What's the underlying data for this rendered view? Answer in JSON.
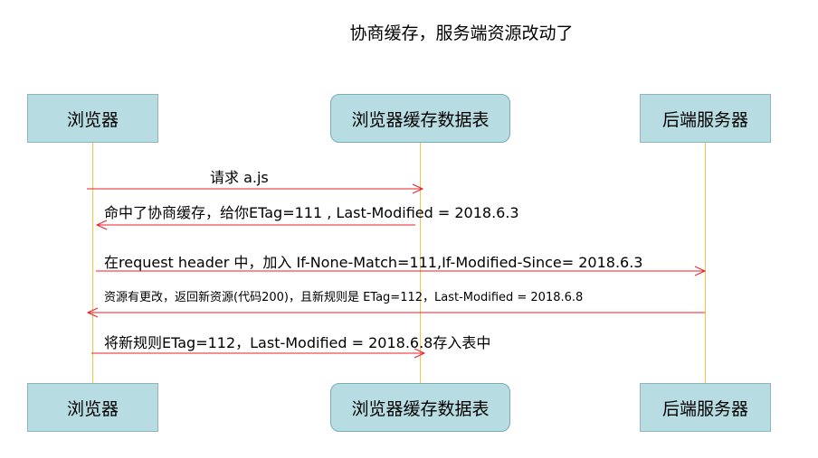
{
  "title": "协商缓存，服务端资源改动了",
  "participants": {
    "browser": "浏览器",
    "cache_table": "浏览器缓存数据表",
    "server": "后端服务器"
  },
  "messages": [
    {
      "text": "请求 a.js",
      "from": "browser",
      "to": "cache_table"
    },
    {
      "text": "命中了协商缓存，给你ETag=111 , Last-Modified = 2018.6.3",
      "from": "cache_table",
      "to": "browser"
    },
    {
      "text": "在request header 中，加入 If-None-Match=111,If-Modified-Since= 2018.6.3",
      "from": "browser",
      "to": "server"
    },
    {
      "text": "资源有更改，返回新资源(代码200)，且新规则是 ETag=112，Last-Modified = 2018.6.8",
      "from": "server",
      "to": "browser"
    },
    {
      "text": "将新规则ETag=112，Last-Modified = 2018.6.8存入表中",
      "from": "browser",
      "to": "cache_table"
    }
  ],
  "colors": {
    "box_fill": "#b7dde3",
    "lifeline": "#f5c542",
    "arrow": "#e8202a"
  }
}
